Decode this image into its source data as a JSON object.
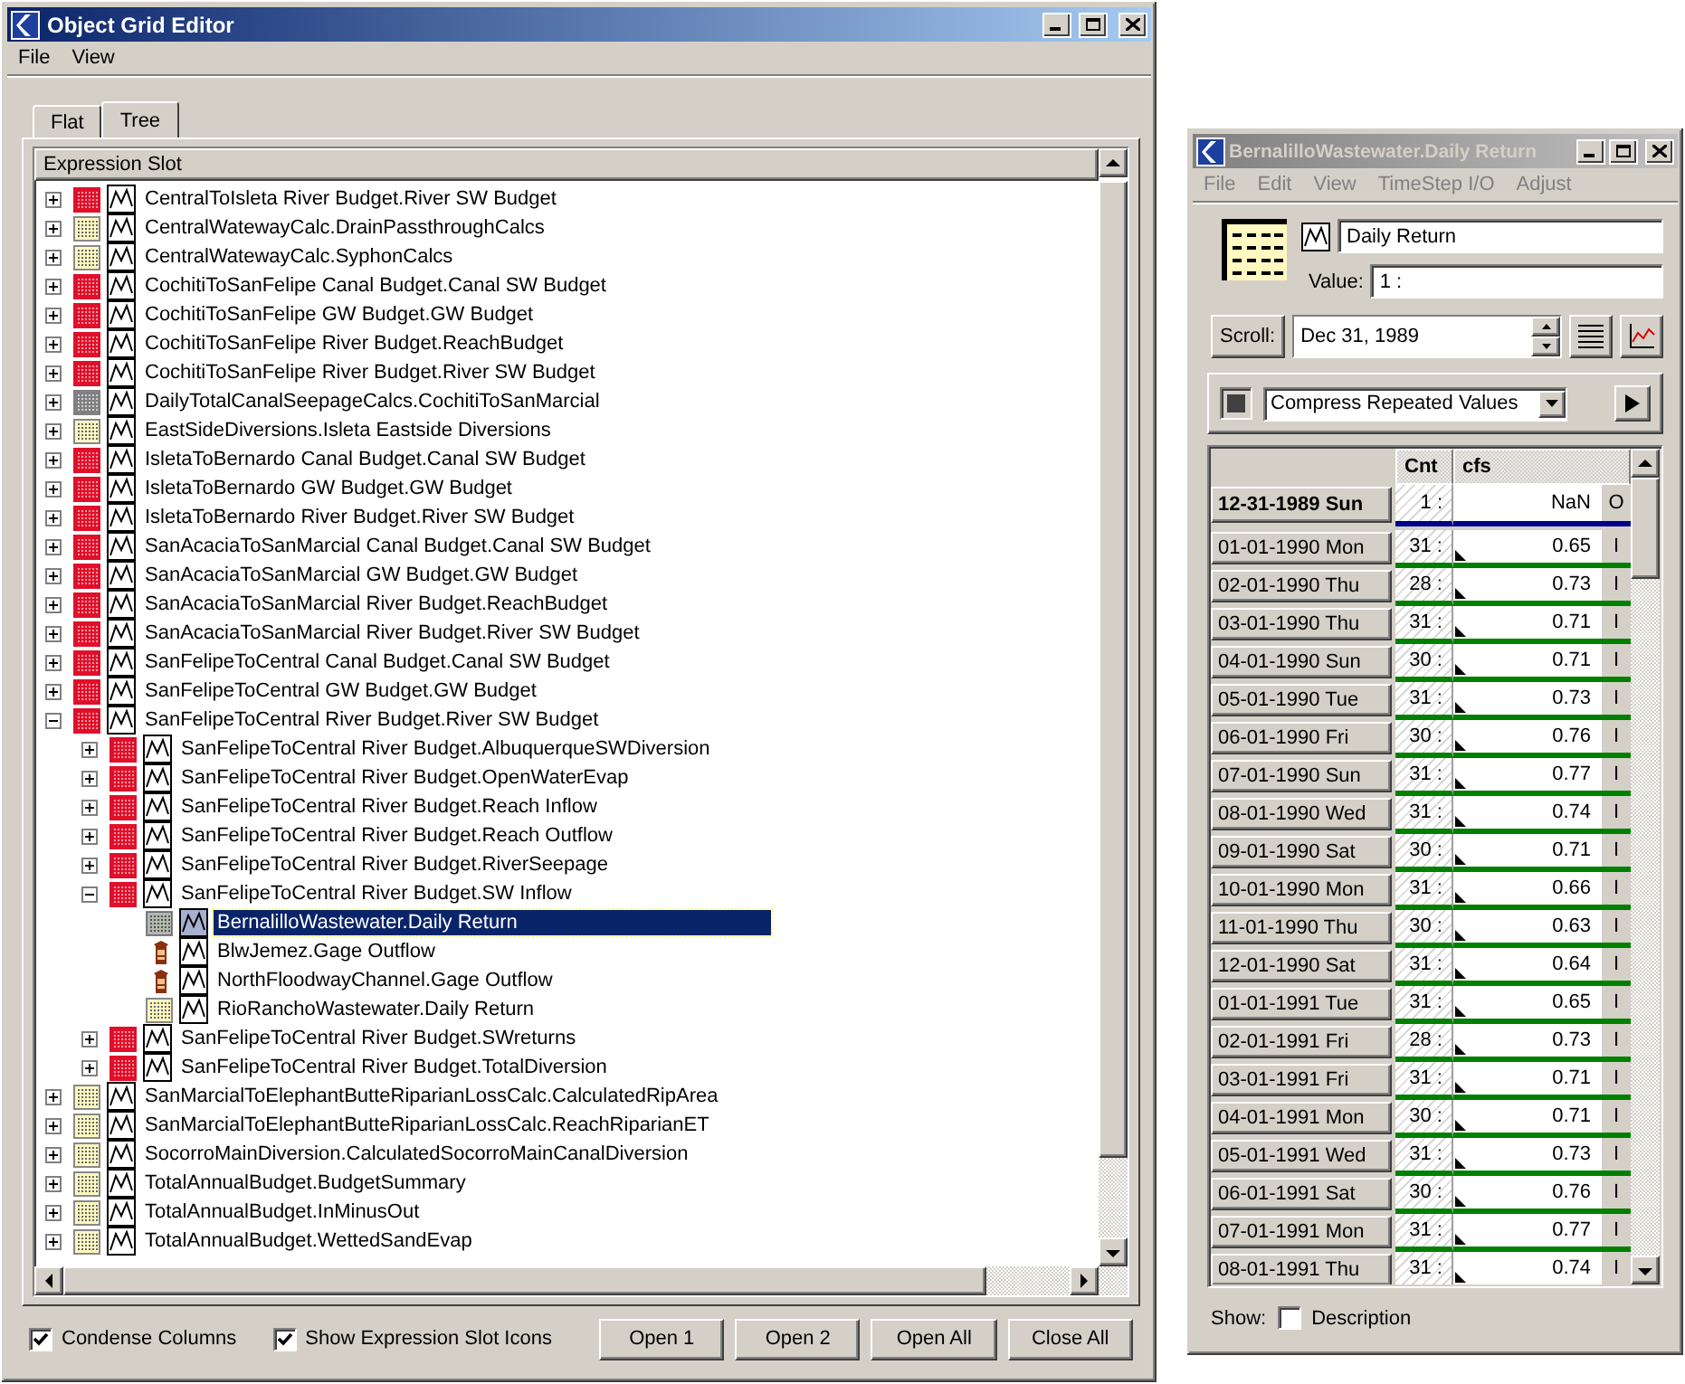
{
  "editor": {
    "title": "Object Grid Editor",
    "active": true,
    "menu": [
      "File",
      "View"
    ],
    "tabs": [
      {
        "label": "Flat",
        "selected": false
      },
      {
        "label": "Tree",
        "selected": true
      }
    ],
    "tree": {
      "header": "Expression Slot",
      "nodes": [
        {
          "label": "CentralToIsleta River Budget.River SW Budget",
          "kind": "budget",
          "expanded": false,
          "selected": false
        },
        {
          "label": "CentralWatewayCalc.DrainPassthroughCalcs",
          "kind": "calc",
          "expanded": false,
          "selected": false
        },
        {
          "label": "CentralWatewayCalc.SyphonCalcs",
          "kind": "calc",
          "expanded": false,
          "selected": false
        },
        {
          "label": "CochitiToSanFelipe Canal Budget.Canal SW Budget",
          "kind": "budget",
          "expanded": false,
          "selected": false
        },
        {
          "label": "CochitiToSanFelipe GW Budget.GW Budget",
          "kind": "budget",
          "expanded": false,
          "selected": false
        },
        {
          "label": "CochitiToSanFelipe River Budget.ReachBudget",
          "kind": "budget",
          "expanded": false,
          "selected": false
        },
        {
          "label": "CochitiToSanFelipe River Budget.River SW Budget",
          "kind": "budget",
          "expanded": false,
          "selected": false
        },
        {
          "label": "DailyTotalCanalSeepageCalcs.CochitiToSanMarcial",
          "kind": "aggregate",
          "expanded": false,
          "selected": false
        },
        {
          "label": "EastSideDiversions.Isleta Eastside Diversions",
          "kind": "calc",
          "expanded": false,
          "selected": false
        },
        {
          "label": "IsletaToBernardo Canal Budget.Canal SW Budget",
          "kind": "budget",
          "expanded": false,
          "selected": false
        },
        {
          "label": "IsletaToBernardo GW Budget.GW Budget",
          "kind": "budget",
          "expanded": false,
          "selected": false
        },
        {
          "label": "IsletaToBernardo River Budget.River SW Budget",
          "kind": "budget",
          "expanded": false,
          "selected": false
        },
        {
          "label": "SanAcaciaToSanMarcial Canal Budget.Canal SW Budget",
          "kind": "budget",
          "expanded": false,
          "selected": false
        },
        {
          "label": "SanAcaciaToSanMarcial GW Budget.GW Budget",
          "kind": "budget",
          "expanded": false,
          "selected": false
        },
        {
          "label": "SanAcaciaToSanMarcial River Budget.ReachBudget",
          "kind": "budget",
          "expanded": false,
          "selected": false
        },
        {
          "label": "SanAcaciaToSanMarcial River Budget.River SW Budget",
          "kind": "budget",
          "expanded": false,
          "selected": false
        },
        {
          "label": "SanFelipeToCentral Canal Budget.Canal SW Budget",
          "kind": "budget",
          "expanded": false,
          "selected": false
        },
        {
          "label": "SanFelipeToCentral GW Budget.GW Budget",
          "kind": "budget",
          "expanded": false,
          "selected": false
        },
        {
          "label": "SanFelipeToCentral River Budget.River SW Budget",
          "kind": "budget",
          "expanded": true,
          "selected": false,
          "children": [
            {
              "label": "SanFelipeToCentral River Budget.AlbuquerqueSWDiversion",
              "kind": "budget",
              "expanded": false,
              "selected": false
            },
            {
              "label": "SanFelipeToCentral River Budget.OpenWaterEvap",
              "kind": "budget",
              "expanded": false,
              "selected": false
            },
            {
              "label": "SanFelipeToCentral River Budget.Reach Inflow",
              "kind": "budget",
              "expanded": false,
              "selected": false
            },
            {
              "label": "SanFelipeToCentral River Budget.Reach Outflow",
              "kind": "budget",
              "expanded": false,
              "selected": false
            },
            {
              "label": "SanFelipeToCentral River Budget.RiverSeepage",
              "kind": "budget",
              "expanded": false,
              "selected": false
            },
            {
              "label": "SanFelipeToCentral River Budget.SW Inflow",
              "kind": "budget",
              "expanded": true,
              "selected": false,
              "children": [
                {
                  "label": "BernalilloWastewater.Daily Return",
                  "kind": "calc",
                  "selected": true
                },
                {
                  "label": "BlwJemez.Gage Outflow",
                  "kind": "gage",
                  "selected": false
                },
                {
                  "label": "NorthFloodwayChannel.Gage Outflow",
                  "kind": "gage",
                  "selected": false
                },
                {
                  "label": "RioRanchoWastewater.Daily Return",
                  "kind": "calc",
                  "selected": false
                }
              ]
            },
            {
              "label": "SanFelipeToCentral River Budget.SWreturns",
              "kind": "budget",
              "expanded": false,
              "selected": false
            },
            {
              "label": "SanFelipeToCentral River Budget.TotalDiversion",
              "kind": "budget",
              "expanded": false,
              "selected": false
            }
          ]
        },
        {
          "label": "SanMarcialToElephantButteRiparianLossCalc.CalculatedRipArea",
          "kind": "calc",
          "expanded": false,
          "selected": false
        },
        {
          "label": "SanMarcialToElephantButteRiparianLossCalc.ReachRiparianET",
          "kind": "calc",
          "expanded": false,
          "selected": false
        },
        {
          "label": "SocorroMainDiversion.CalculatedSocorroMainCanalDiversion",
          "kind": "calc",
          "expanded": false,
          "selected": false
        },
        {
          "label": "TotalAnnualBudget.BudgetSummary",
          "kind": "calc",
          "expanded": false,
          "selected": false
        },
        {
          "label": "TotalAnnualBudget.InMinusOut",
          "kind": "calc",
          "expanded": false,
          "selected": false
        },
        {
          "label": "TotalAnnualBudget.WettedSandEvap",
          "kind": "calc",
          "expanded": false,
          "selected": false
        }
      ]
    },
    "options": [
      {
        "label": "Condense Columns",
        "checked": true
      },
      {
        "label": "Show Expression Slot Icons",
        "checked": true
      }
    ],
    "buttons": [
      "Open 1",
      "Open 2",
      "Open All",
      "Close All"
    ]
  },
  "series_window": {
    "title": "BernalilloWastewater.Daily Return",
    "active": false,
    "menu": [
      "File",
      "Edit",
      "View",
      "TimeStep I/O",
      "Adjust"
    ],
    "slot_name": "Daily Return",
    "value_label": "Value:",
    "value": "1 :",
    "scroll_label": "Scroll:",
    "scroll_date": "Dec 31, 1989",
    "display_mode": "Compress Repeated Values",
    "table": {
      "columns": [
        "Cnt",
        "cfs"
      ],
      "rows": [
        {
          "kind": "initial",
          "date": "12-31-1989 Sun",
          "count": "1 :",
          "value": "NaN",
          "flag": "O"
        },
        {
          "kind": "data",
          "date": "01-01-1990 Mon",
          "count": "31 :",
          "value": "0.65",
          "flag": "I"
        },
        {
          "kind": "data",
          "date": "02-01-1990 Thu",
          "count": "28 :",
          "value": "0.73",
          "flag": "I"
        },
        {
          "kind": "data",
          "date": "03-01-1990 Thu",
          "count": "31 :",
          "value": "0.71",
          "flag": "I"
        },
        {
          "kind": "data",
          "date": "04-01-1990 Sun",
          "count": "30 :",
          "value": "0.71",
          "flag": "I"
        },
        {
          "kind": "data",
          "date": "05-01-1990 Tue",
          "count": "31 :",
          "value": "0.73",
          "flag": "I"
        },
        {
          "kind": "data",
          "date": "06-01-1990 Fri",
          "count": "30 :",
          "value": "0.76",
          "flag": "I"
        },
        {
          "kind": "data",
          "date": "07-01-1990 Sun",
          "count": "31 :",
          "value": "0.77",
          "flag": "I"
        },
        {
          "kind": "data",
          "date": "08-01-1990 Wed",
          "count": "31 :",
          "value": "0.74",
          "flag": "I"
        },
        {
          "kind": "data",
          "date": "09-01-1990 Sat",
          "count": "30 :",
          "value": "0.71",
          "flag": "I"
        },
        {
          "kind": "data",
          "date": "10-01-1990 Mon",
          "count": "31 :",
          "value": "0.66",
          "flag": "I"
        },
        {
          "kind": "data",
          "date": "11-01-1990 Thu",
          "count": "30 :",
          "value": "0.63",
          "flag": "I"
        },
        {
          "kind": "data",
          "date": "12-01-1990 Sat",
          "count": "31 :",
          "value": "0.64",
          "flag": "I"
        },
        {
          "kind": "data",
          "date": "01-01-1991 Tue",
          "count": "31 :",
          "value": "0.65",
          "flag": "I"
        },
        {
          "kind": "data",
          "date": "02-01-1991 Fri",
          "count": "28 :",
          "value": "0.73",
          "flag": "I"
        },
        {
          "kind": "data",
          "date": "03-01-1991 Fri",
          "count": "31 :",
          "value": "0.71",
          "flag": "I"
        },
        {
          "kind": "data",
          "date": "04-01-1991 Mon",
          "count": "30 :",
          "value": "0.71",
          "flag": "I"
        },
        {
          "kind": "data",
          "date": "05-01-1991 Wed",
          "count": "31 :",
          "value": "0.73",
          "flag": "I"
        },
        {
          "kind": "data",
          "date": "06-01-1991 Sat",
          "count": "30 :",
          "value": "0.76",
          "flag": "I"
        },
        {
          "kind": "data",
          "date": "07-01-1991 Mon",
          "count": "31 :",
          "value": "0.77",
          "flag": "I"
        },
        {
          "kind": "data",
          "date": "08-01-1991 Thu",
          "count": "31 :",
          "value": "0.74",
          "flag": "I"
        }
      ]
    },
    "show_label": "Show:",
    "description": {
      "label": "Description",
      "checked": false
    }
  }
}
